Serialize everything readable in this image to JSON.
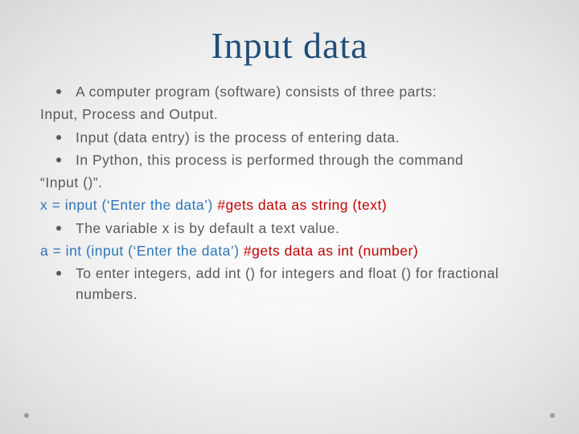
{
  "title": "Input data",
  "lines": {
    "b1": "A computer program (software) consists of three parts:",
    "p1": "Input, Process and Output.",
    "b2": "Input (data entry) is the process of entering data.",
    "b3": "In Python, this process is performed through the command",
    "p2": "“Input ()”.",
    "code1_blue": "x = input (‘Enter the data’)    ",
    "code1_red": "#gets data as string (text)",
    "b4": "The variable x is by default a text value.",
    "code2_blue": "a = int (input (‘Enter the data’) ",
    "code2_red": "#gets data as int (number)",
    "b5": "To enter integers, add int () for integers and float () for fractional numbers."
  }
}
